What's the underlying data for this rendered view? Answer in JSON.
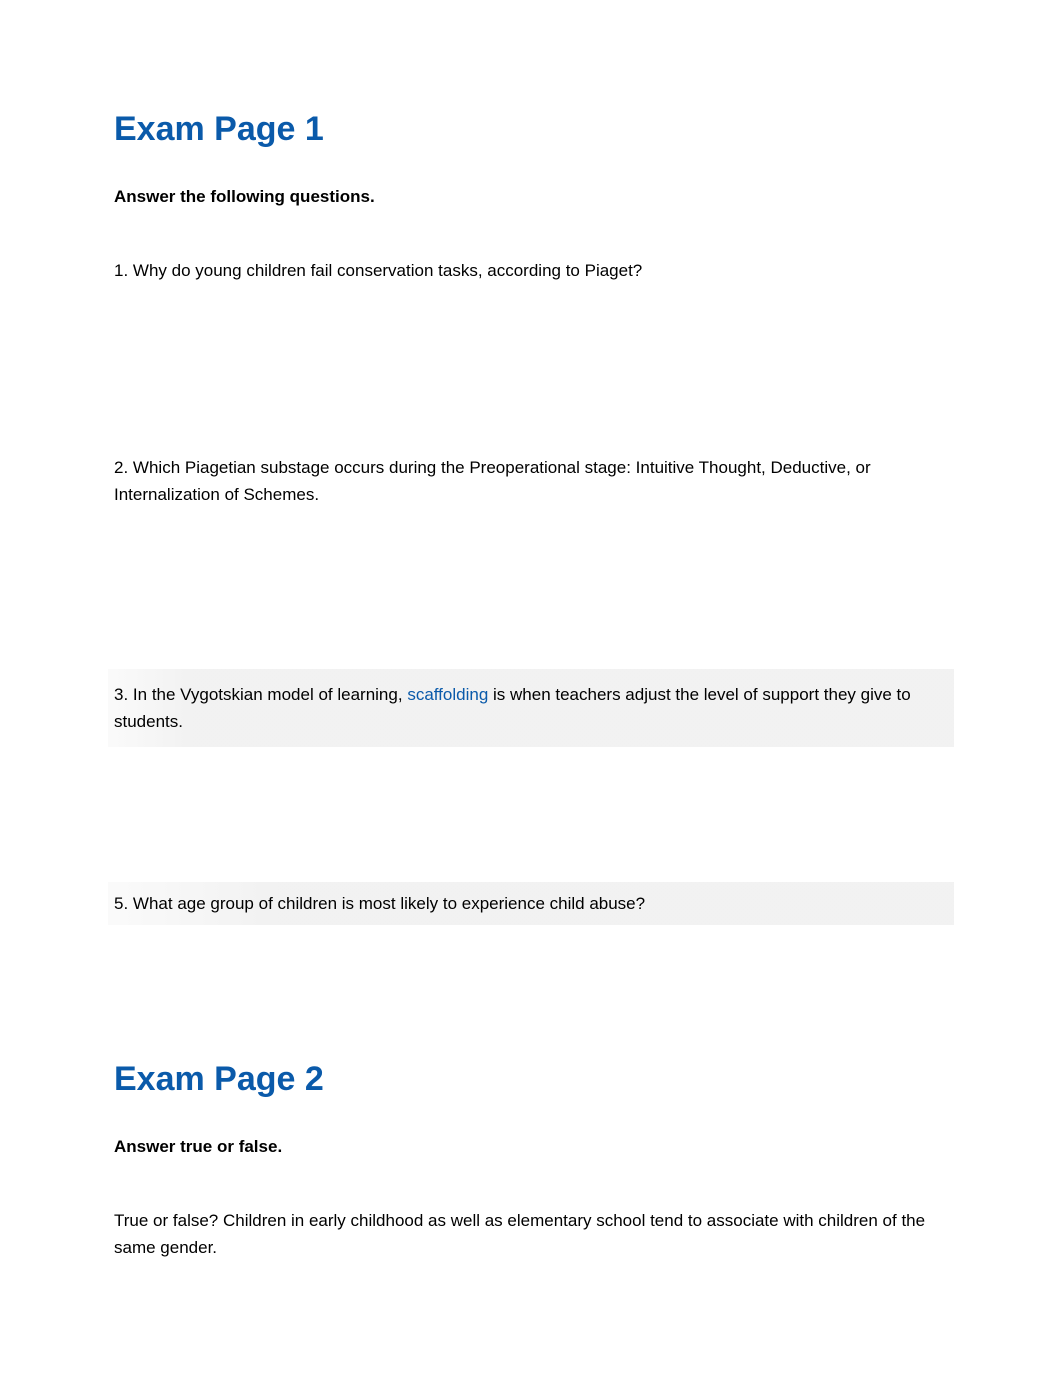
{
  "page1": {
    "title": "Exam Page 1",
    "instructions": "Answer the following questions.",
    "questions": {
      "q1": {
        "number": "1.",
        "text": "Why do young children fail conservation tasks, according to Piaget?"
      },
      "q2": {
        "number": "2.",
        "text": "Which Piagetian substage occurs during the Preoperational stage: Intuitive Thought, Deductive, or Internalization of Schemes."
      },
      "q3": {
        "number": "3.",
        "prefix": "In the Vygotskian model of learning,",
        "link": "scaffolding",
        "suffix": "is when teachers adjust the level of support they give to students."
      },
      "q5": {
        "number": "5.",
        "text": "What age group of children is most likely to experience child abuse?"
      }
    }
  },
  "page2": {
    "title": "Exam Page 2",
    "instructions": "Answer true or false.",
    "questions": {
      "q1": {
        "text": "True or false? Children in early childhood as well as elementary school tend to associate with children of the same gender."
      }
    }
  }
}
